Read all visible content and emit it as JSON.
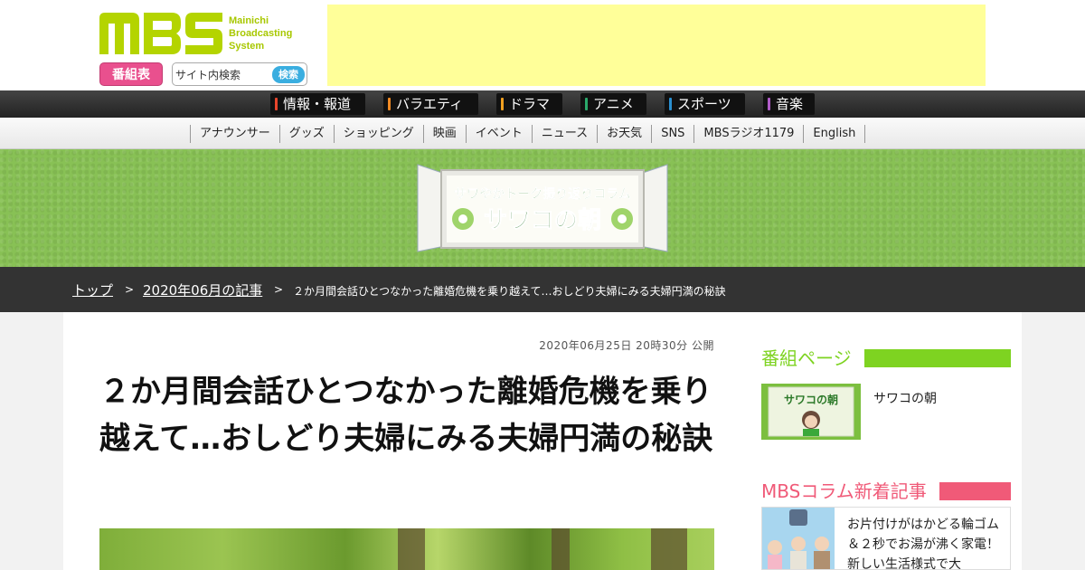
{
  "header": {
    "logo_text": "MBS",
    "logo_sub": [
      "Mainichi",
      "Broadcasting",
      "System"
    ],
    "program_guide_label": "番組表",
    "search": {
      "value": "サイト内検索",
      "button_label": "検索"
    }
  },
  "genre_nav": [
    {
      "label": "情報・報道",
      "color": "#e8452c"
    },
    {
      "label": "バラエティ",
      "color": "#f08a24"
    },
    {
      "label": "ドラマ",
      "color": "#f0a020"
    },
    {
      "label": "アニメ",
      "color": "#2aa86a"
    },
    {
      "label": "スポーツ",
      "color": "#2a8fd0"
    },
    {
      "label": "音楽",
      "color": "#b05cc8"
    }
  ],
  "sub_nav": [
    "アナウンサー",
    "グッズ",
    "ショッピング",
    "映画",
    "イベント",
    "ニュース",
    "お天気",
    "SNS",
    "MBSラジオ1179",
    "English"
  ],
  "banner": {
    "line1": "サワやかトーク振り返りコラム",
    "line2": "サワコの朝"
  },
  "breadcrumb": {
    "top": "トップ",
    "sep": ">",
    "month": "2020年06月の記事",
    "current": "２か月間会話ひとつなかった離婚危機を乗り越えて…おしどり夫婦にみる夫婦円満の秘訣"
  },
  "article": {
    "date": "2020年06月25日 20時30分 公開",
    "title": "２か月間会話ひとつなかった離婚危機を乗り越えて…おしどり夫婦にみる夫婦円満の秘訣"
  },
  "sidebar": {
    "program_heading": "番組ページ",
    "program_heading_color": "#7ed321",
    "program_name": "サワコの朝",
    "thumb_text": "サワコの朝",
    "column_heading": "MBSコラム新着記事",
    "column_heading_color": "#f05a78",
    "latest_article": "お片付けがはかどる輪ゴム＆２秒でお湯が沸く家電！新しい生活様式で大"
  },
  "colors": {
    "brand": "#b4d400",
    "program_button": "#e9508e",
    "search_button": "#3aaee0",
    "ad_placeholder": "#ffff99",
    "banner_green": "#88c155"
  }
}
